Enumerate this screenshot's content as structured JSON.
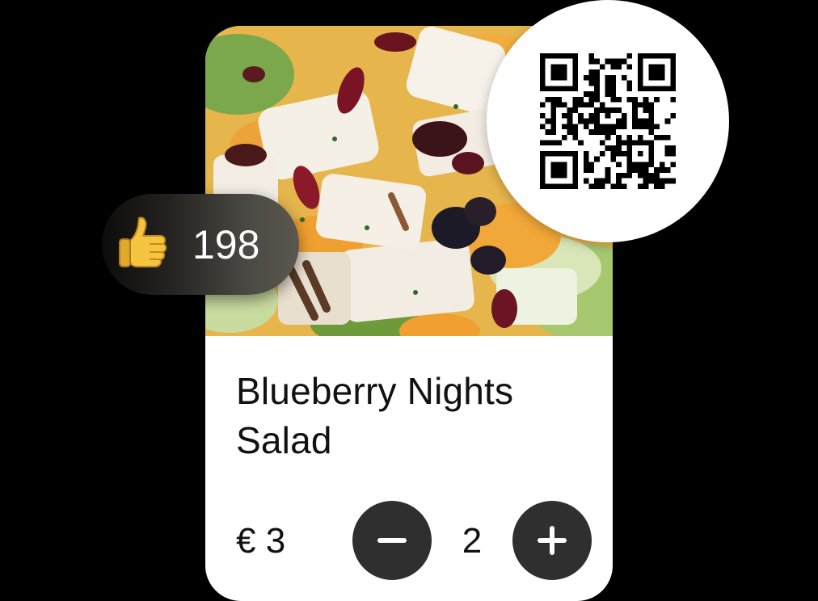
{
  "product": {
    "title": "Blueberry Nights Salad",
    "price": "€ 3",
    "quantity": "2"
  },
  "likes": {
    "count": "198",
    "icon": "thumbs-up-icon"
  },
  "icons": {
    "decrement": "minus-icon",
    "increment": "plus-icon",
    "qr": "qr-code-icon"
  },
  "colors": {
    "background": "#000000",
    "card": "#ffffff",
    "button": "#2f2f2f",
    "text": "#111111",
    "likes_pill_start": "#0c0c0a",
    "likes_pill_end": "#5a5750"
  }
}
